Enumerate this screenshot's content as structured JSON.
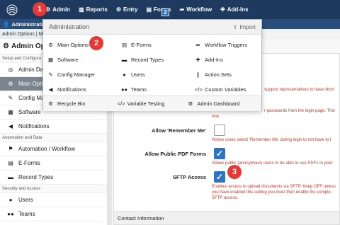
{
  "topbar": {
    "items": [
      {
        "label": "Admin",
        "icon": "gear-icon"
      },
      {
        "label": "Reports",
        "icon": "bar-chart-icon"
      },
      {
        "label": "Entry",
        "icon": "gear-icon"
      },
      {
        "label": "Forms",
        "icon": "document-icon"
      },
      {
        "label": "Workflow",
        "icon": "arrow-icon"
      },
      {
        "label": "Add-Ins",
        "icon": "puzzle-icon"
      }
    ],
    "badges": {
      "b1": "1",
      "b2": "2",
      "b3": "3",
      "sq": "2"
    }
  },
  "subbar": {
    "label": "Administrative"
  },
  "breadcrumb": {
    "text": "Admin Options | M"
  },
  "sidebar": {
    "title": "Admin Option",
    "section1": "Setup and Configura",
    "items1": [
      {
        "label": "Admin Das",
        "icon": "dashboard-icon"
      },
      {
        "label": "Main Optio",
        "icon": "cogs-icon"
      },
      {
        "label": "Config Ma",
        "icon": "edit-icon"
      },
      {
        "label": "Software",
        "icon": "grid-icon"
      },
      {
        "label": "Notifications",
        "icon": "bullhorn-icon"
      }
    ],
    "section2": "Automation and Data",
    "items2": [
      {
        "label": "Automation / Workflow",
        "icon": "flag-icon"
      },
      {
        "label": "E-Forms",
        "icon": "form-icon"
      },
      {
        "label": "Record Types",
        "icon": "folder-icon"
      }
    ],
    "section3": "Security and Access",
    "items3": [
      {
        "label": "Users",
        "icon": "user-icon"
      },
      {
        "label": "Teams",
        "icon": "users-icon"
      }
    ]
  },
  "main": {
    "desc_top1": "support representatives to have short",
    "desc_top2": "r passwords from the login page. This",
    "desc_top3": "one.",
    "remember_label": "Allow 'Remember Me'",
    "remember_desc": "Allows users select 'Remember Me' during login to not have to l",
    "pdf_label": "Allow Public PDF Forms",
    "pdf_desc": "Allows public (anonymous) users to be able to use PDFs to post",
    "sftp_label": "SFTP Access",
    "sftp_desc1": "Enables access to upload documents via SFTP. Keep OFF unless",
    "sftp_desc2": "you have enabled this setting you must then enable the comple",
    "sftp_desc3": "SFTP access.",
    "contact": "Contact Information"
  },
  "dropdown": {
    "title": "Administration",
    "import": "Import",
    "items": [
      {
        "label": "Main Options",
        "icon": "gear-icon"
      },
      {
        "label": "E-Forms",
        "icon": "form-icon"
      },
      {
        "label": "Workflow Triggers",
        "icon": "arrow-icon"
      },
      {
        "label": "Software",
        "icon": "grid-icon"
      },
      {
        "label": "Record Types",
        "icon": "folder-icon"
      },
      {
        "label": "Add-Ins",
        "icon": "puzzle-icon"
      },
      {
        "label": "Config Manager",
        "icon": "edit-icon"
      },
      {
        "label": "Users",
        "icon": "user-icon"
      },
      {
        "label": "Action Sets",
        "icon": "pause-icon"
      },
      {
        "label": "Notifications",
        "icon": "bullhorn-icon"
      },
      {
        "label": "Teams",
        "icon": "users-icon"
      },
      {
        "label": "Custom Variables",
        "icon": "code-icon"
      }
    ],
    "footer": [
      {
        "label": "Recycle Bin",
        "icon": "gear-icon"
      },
      {
        "label": "Variable Testing",
        "icon": "code-icon"
      },
      {
        "label": "Admin Dashboard",
        "icon": "gear-icon"
      }
    ]
  }
}
